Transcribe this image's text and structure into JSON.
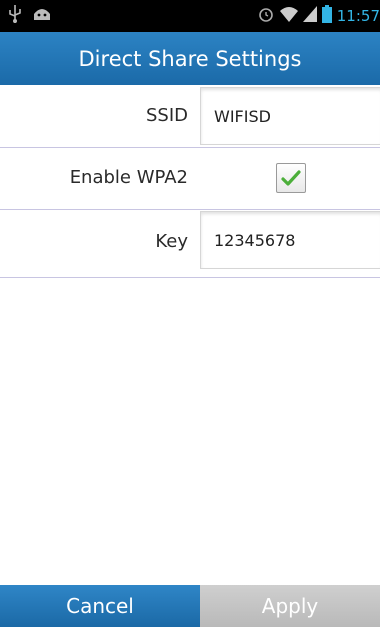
{
  "status_bar": {
    "time": "11:57",
    "icons": [
      "usb-icon",
      "android-icon",
      "alarm-icon",
      "wifi-icon",
      "signal-icon",
      "battery-icon"
    ],
    "time_color": "#33b5e5"
  },
  "header": {
    "title": "Direct Share Settings",
    "color": "#1e6fae"
  },
  "form": {
    "ssid": {
      "label": "SSID",
      "value": "WIFISD"
    },
    "wpa2": {
      "label": "Enable WPA2",
      "checked": true
    },
    "key": {
      "label": "Key",
      "value": "12345678"
    }
  },
  "buttons": {
    "cancel_label": "Cancel",
    "apply_label": "Apply",
    "apply_enabled": false
  }
}
